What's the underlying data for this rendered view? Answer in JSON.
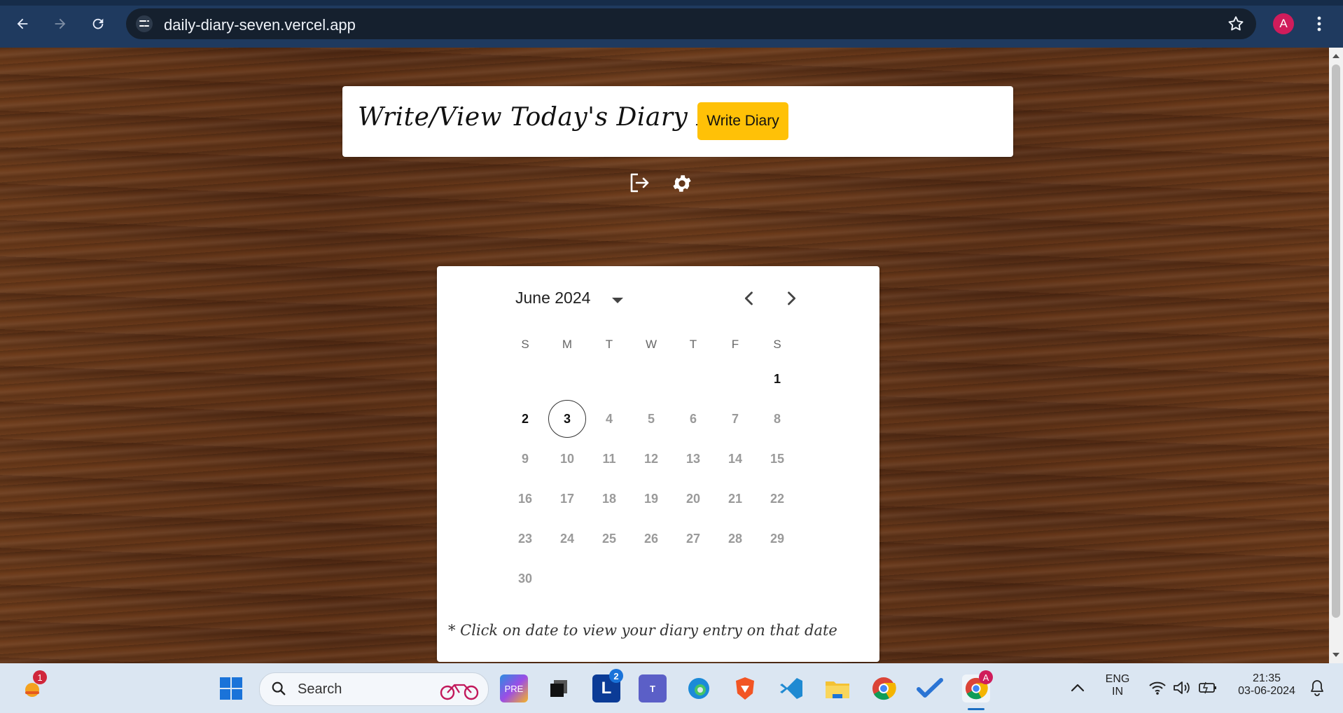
{
  "browser": {
    "url": "daily-diary-seven.vercel.app",
    "profile_initial": "A"
  },
  "header": {
    "title": "Write/View Today's Diary Entry",
    "write_button": "Write Diary"
  },
  "calendar": {
    "month_label": "June 2024",
    "weekdays": [
      "S",
      "M",
      "T",
      "W",
      "T",
      "F",
      "S"
    ],
    "days": [
      "1",
      "2",
      "3",
      "4",
      "5",
      "6",
      "7",
      "8",
      "9",
      "10",
      "11",
      "12",
      "13",
      "14",
      "15",
      "16",
      "17",
      "18",
      "19",
      "20",
      "21",
      "22",
      "23",
      "24",
      "25",
      "26",
      "27",
      "28",
      "29",
      "30"
    ],
    "selected_day": "3",
    "note": "* Click on date to view your diary entry on that date"
  },
  "taskbar": {
    "search_placeholder": "Search",
    "weather_badge": "1",
    "lens_badge": "2",
    "chrome_badge": "A",
    "language_line1": "ENG",
    "language_line2": "IN",
    "time": "21:35",
    "date": "03-06-2024"
  },
  "colors": {
    "accent": "#ffc107",
    "browser_bar": "#1f3a5f",
    "taskbar": "#dbe6f2"
  }
}
